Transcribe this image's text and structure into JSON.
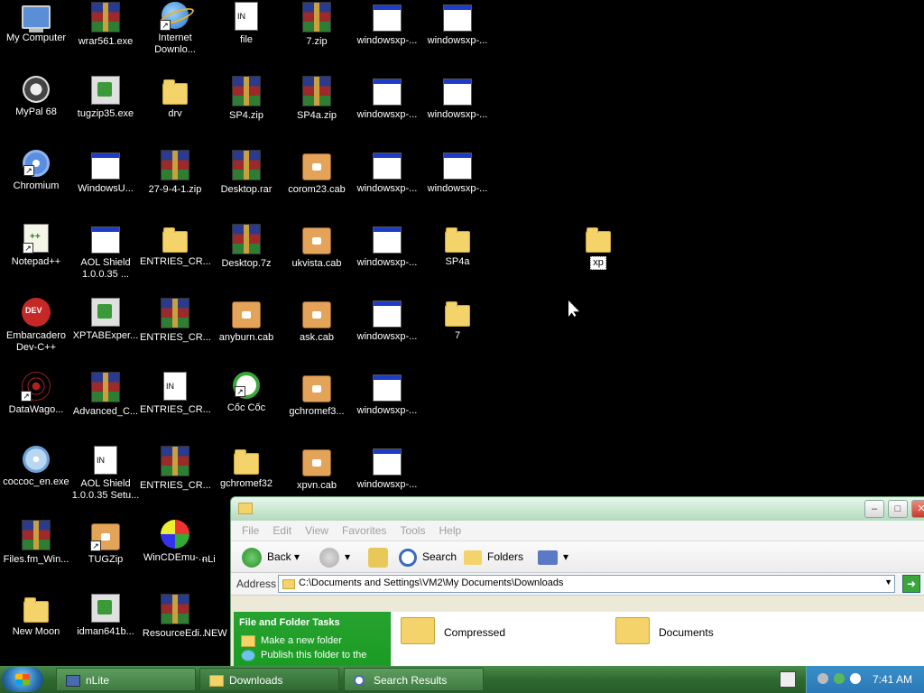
{
  "desktop": {
    "icons": [
      {
        "label": "My Computer"
      },
      {
        "label": "wrar561.exe"
      },
      {
        "label": "Internet\nDownlo..."
      },
      {
        "label": "file"
      },
      {
        "label": "7.zip"
      },
      {
        "label": "windowsxp-..."
      },
      {
        "label": "windowsxp-..."
      },
      {
        "label": "MyPal 68"
      },
      {
        "label": "tugzip35.exe"
      },
      {
        "label": "drv"
      },
      {
        "label": "SP4.zip"
      },
      {
        "label": "SP4a.zip"
      },
      {
        "label": "windowsxp-..."
      },
      {
        "label": "windowsxp-..."
      },
      {
        "label": "Chromium"
      },
      {
        "label": "WindowsU..."
      },
      {
        "label": "27-9-4-1.zip"
      },
      {
        "label": "Desktop.rar"
      },
      {
        "label": "corom23.cab"
      },
      {
        "label": "windowsxp-..."
      },
      {
        "label": "windowsxp-..."
      },
      {
        "label": "Notepad++"
      },
      {
        "label": "AOL Shield\n1.0.0.35 ..."
      },
      {
        "label": "ENTRIES_CR..."
      },
      {
        "label": "Desktop.7z"
      },
      {
        "label": "ukvista.cab"
      },
      {
        "label": "windowsxp-..."
      },
      {
        "label": "SP4a"
      },
      {
        "label": "xp"
      },
      {
        "label": "Embarcadero\nDev-C++"
      },
      {
        "label": "XPTABExper..."
      },
      {
        "label": "ENTRIES_CR..."
      },
      {
        "label": "anyburn.cab"
      },
      {
        "label": "ask.cab"
      },
      {
        "label": "windowsxp-..."
      },
      {
        "label": "7"
      },
      {
        "label": "DataWago..."
      },
      {
        "label": "Advanced_C..."
      },
      {
        "label": "ENTRIES_CR..."
      },
      {
        "label": "Cốc Cốc"
      },
      {
        "label": "gchromef3..."
      },
      {
        "label": "windowsxp-..."
      },
      {
        "label": "coccoc_en.exe"
      },
      {
        "label": "AOL Shield\n1.0.0.35 Setu..."
      },
      {
        "label": "ENTRIES_CR..."
      },
      {
        "label": "gchromef32"
      },
      {
        "label": "xpvn.cab"
      },
      {
        "label": "windowsxp-..."
      },
      {
        "label": "Files.fm_Win..."
      },
      {
        "label": "TUGZip"
      },
      {
        "label": "WinCDEmu-..."
      },
      {
        "label": "nLi"
      },
      {
        "label": "New Moon"
      },
      {
        "label": "idman641b..."
      },
      {
        "label": "ResourceEdi..."
      },
      {
        "label": "NEW"
      }
    ]
  },
  "explorer": {
    "menu": [
      "File",
      "Edit",
      "View",
      "Favorites",
      "Tools",
      "Help"
    ],
    "toolbar": {
      "back": "Back",
      "search": "Search",
      "folders": "Folders"
    },
    "address_label": "Address",
    "address_value": "C:\\Documents and Settings\\VM2\\My Documents\\Downloads",
    "task_pane": {
      "title": "File and Folder Tasks",
      "items": [
        "Make a new folder",
        "Publish this folder to the"
      ]
    },
    "files": [
      "Compressed",
      "Documents"
    ]
  },
  "taskbar": {
    "tasks": [
      "nLite",
      "Downloads",
      "Search Results"
    ],
    "clock": "7:41 AM"
  },
  "colors": {
    "taskbar": "#2f6a30",
    "titlebar": "#c5e6cf",
    "task_pane": "#1f9e27",
    "tray": "#2a78b8"
  }
}
